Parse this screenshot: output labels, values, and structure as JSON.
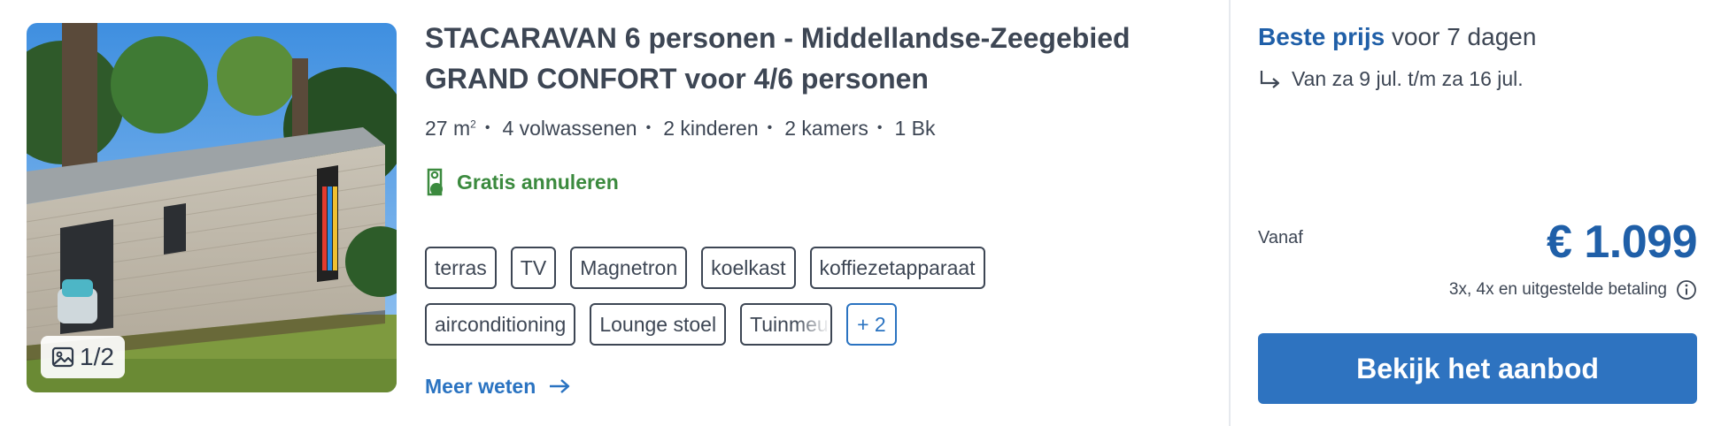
{
  "listing": {
    "title": "STACARAVAN 6 personen - Middellandse-Zeegebied GRAND CONFORT voor 4/6 personen",
    "photo_counter": "1/2",
    "specs": {
      "area_value": "27 m",
      "area_unit_sup": "2",
      "adults": "4 volwassenen",
      "children": "2 kinderen",
      "rooms": "2 kamers",
      "beds": "1 Bk"
    },
    "cancellation": "Gratis annuleren",
    "amenities_row1": [
      "terras",
      "TV",
      "Magnetron",
      "koelkast",
      "koffiezetapparaat"
    ],
    "amenities_row2": [
      "airconditioning",
      "Lounge stoel",
      "Tuinmeubelen"
    ],
    "more_amenities": "+ 2",
    "more_link": "Meer weten"
  },
  "pricing": {
    "best_price_label": "Beste prijs",
    "duration": "voor 7 dagen",
    "dates": "Van za 9 jul. t/m za 16 jul.",
    "from_label": "Vanaf",
    "price": "€ 1.099",
    "payment_options": "3x, 4x en uitgestelde betaling",
    "cta": "Bekijk het aanbod"
  },
  "colors": {
    "accent_blue": "#1f5fa8",
    "button_blue": "#2e73c0",
    "link_blue": "#2a73c1",
    "green": "#3b8a3e",
    "text": "#3d4654"
  }
}
